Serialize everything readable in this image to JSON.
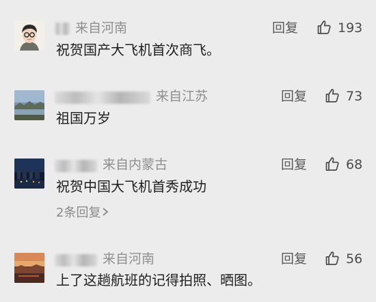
{
  "comments": [
    {
      "location": "来自河南",
      "text": "祝贺国产大飞机首次商飞。",
      "reply_label": "回复",
      "likes": "193",
      "avatar": "cartoon-person-avatar"
    },
    {
      "location": "来自江苏",
      "text": "祖国万岁",
      "reply_label": "回复",
      "likes": "73",
      "avatar": "landscape-photo-avatar"
    },
    {
      "location": "来自内蒙古",
      "text": "祝贺中国大飞机首秀成功",
      "reply_label": "回复",
      "likes": "68",
      "avatar": "night-city-photo-avatar",
      "sub_replies": "2条回复"
    },
    {
      "location": "来自河南",
      "text": "上了这趟航班的记得拍照、晒图。",
      "reply_label": "回复",
      "likes": "56",
      "avatar": "sunset-photo-avatar"
    }
  ]
}
